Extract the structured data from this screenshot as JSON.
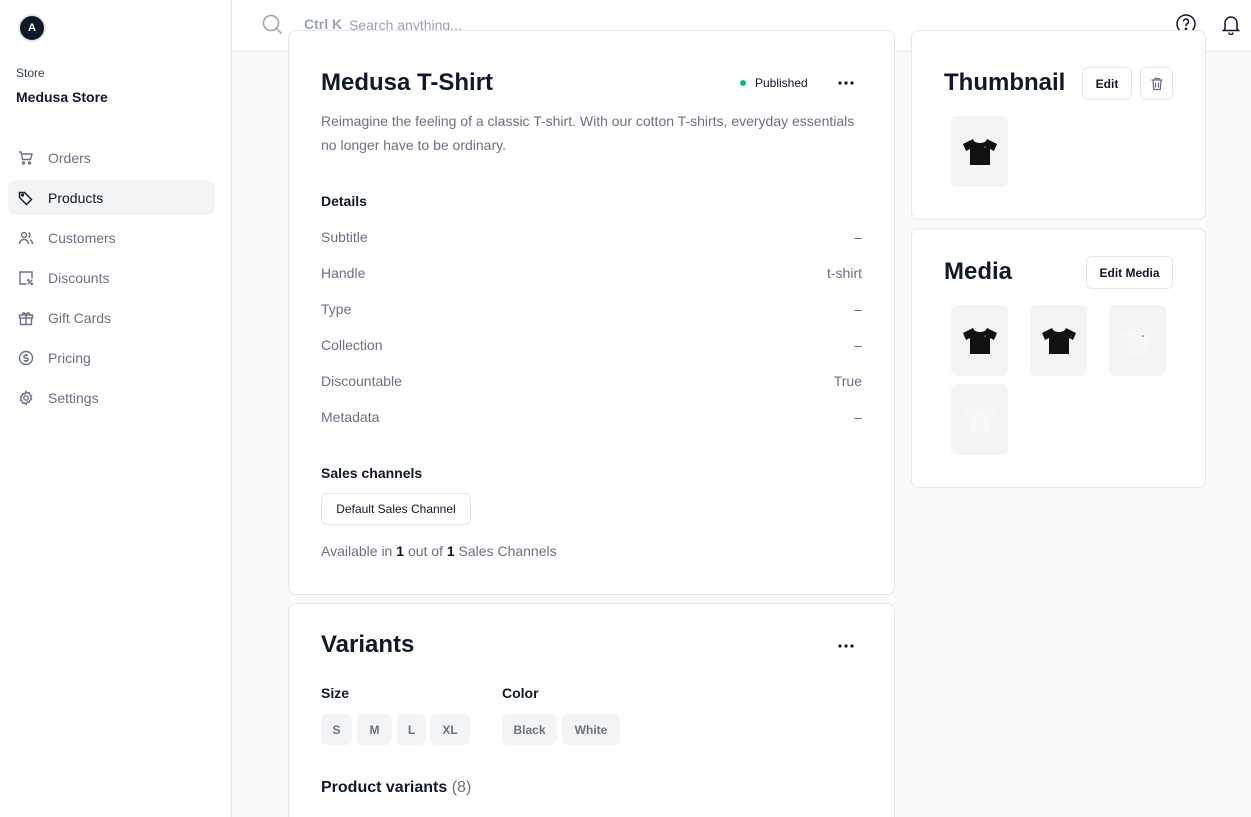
{
  "sidebar": {
    "avatar_letter": "A",
    "store_label": "Store",
    "store_name": "Medusa Store",
    "items": [
      {
        "label": "Orders",
        "icon": "cart-icon"
      },
      {
        "label": "Products",
        "icon": "tag-icon",
        "active": true
      },
      {
        "label": "Customers",
        "icon": "users-icon"
      },
      {
        "label": "Discounts",
        "icon": "discount-icon"
      },
      {
        "label": "Gift Cards",
        "icon": "gift-icon"
      },
      {
        "label": "Pricing",
        "icon": "pricing-icon"
      },
      {
        "label": "Settings",
        "icon": "gear-icon"
      }
    ]
  },
  "topbar": {
    "shortcut": "Ctrl K",
    "search_placeholder": "Search anything..."
  },
  "product": {
    "title": "Medusa T-Shirt",
    "status": "Published",
    "status_color": "#10b981",
    "description": "Reimagine the feeling of a classic T-shirt. With our cotton T-shirts, everyday essentials no longer have to be ordinary.",
    "details_title": "Details",
    "details": [
      {
        "label": "Subtitle",
        "value": "–"
      },
      {
        "label": "Handle",
        "value": "t-shirt"
      },
      {
        "label": "Type",
        "value": "–"
      },
      {
        "label": "Collection",
        "value": "–"
      },
      {
        "label": "Discountable",
        "value": "True"
      },
      {
        "label": "Metadata",
        "value": "–"
      }
    ],
    "sales_channels_title": "Sales channels",
    "sales_channel": "Default Sales Channel",
    "available_prefix": "Available in",
    "available_count": "1",
    "available_middle": "out of",
    "available_total": "1",
    "available_suffix": "Sales Channels"
  },
  "variants": {
    "title": "Variants",
    "size_label": "Size",
    "sizes": [
      "S",
      "M",
      "L",
      "XL"
    ],
    "color_label": "Color",
    "colors": [
      "Black",
      "White"
    ],
    "product_variants_label": "Product variants",
    "product_variants_count": "(8)"
  },
  "thumbnail": {
    "title": "Thumbnail",
    "edit_label": "Edit"
  },
  "media": {
    "title": "Media",
    "edit_label": "Edit Media",
    "images": [
      "black",
      "black",
      "white",
      "white"
    ]
  }
}
